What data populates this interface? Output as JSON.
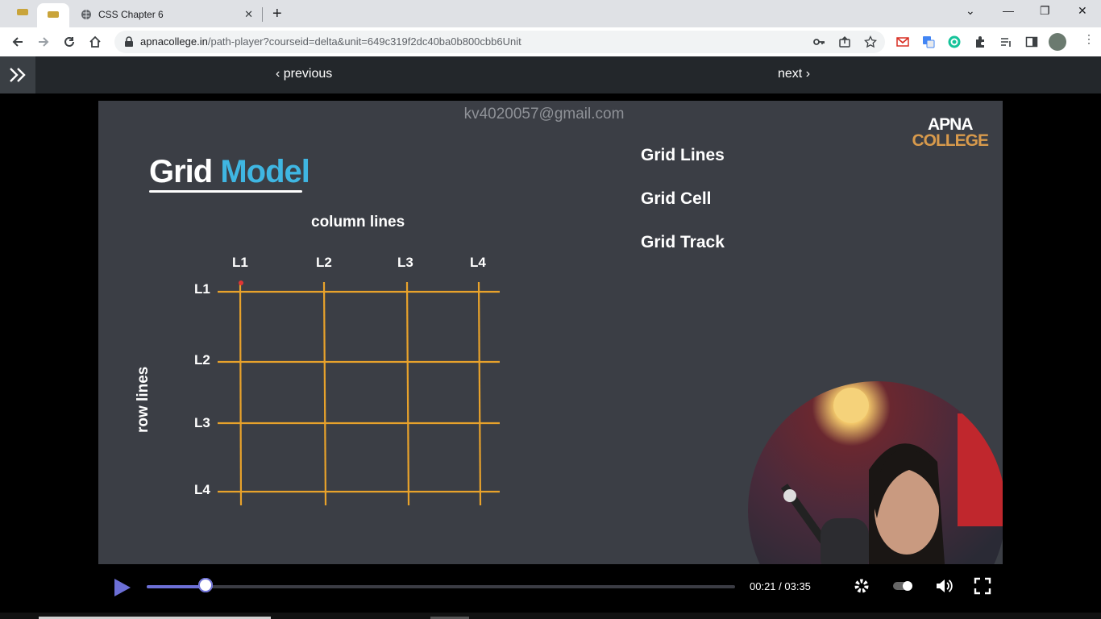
{
  "browser": {
    "active_tab_title": "CSS Chapter 6",
    "url_host": "apnacollege.in",
    "url_path": "/path-player?courseid=delta&unit=649c319f2dc40ba0b800cbb6Unit"
  },
  "app_nav": {
    "prev_label": "‹ previous",
    "next_label": "next ›"
  },
  "slide": {
    "watermark": "kv4020057@gmail.com",
    "brand_top": "APNA",
    "brand_bottom": "COLLEGE",
    "title_main": "Grid",
    "title_accent": "Model",
    "column_heading": "column lines",
    "row_heading": "row lines",
    "column_labels": [
      "L1",
      "L2",
      "L3",
      "L4"
    ],
    "row_labels": [
      "L1",
      "L2",
      "L3",
      "L4"
    ],
    "side_items": [
      "Grid Lines",
      "Grid Cell",
      "Grid Track"
    ],
    "accent_color": "#3fb6e2",
    "grid_line_color": "#e8a22b"
  },
  "player": {
    "time_current": "00:21",
    "time_total": "03:35",
    "time_display": "00:21 / 03:35",
    "progress_fraction": 0.1,
    "accent_color": "#6c6fd6"
  }
}
